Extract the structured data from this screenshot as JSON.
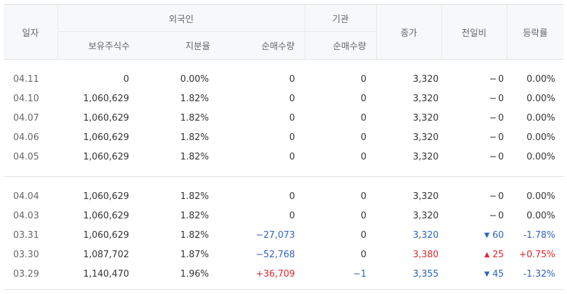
{
  "header": {
    "date": "일자",
    "foreign": "외국인",
    "institution": "기관",
    "close": "종가",
    "change": "전일비",
    "rate": "등락률",
    "holdings": "보유주식수",
    "ratio": "지분율",
    "foreign_net": "순매수량",
    "inst_net": "순매수량"
  },
  "colors": {
    "up": "#e0262b",
    "down": "#2d63c8",
    "header_bg": "#f7f8fa"
  },
  "groups": [
    {
      "rows": [
        {
          "date": "04.11",
          "holdings": "0",
          "ratio": "0.00%",
          "foreign_net": "0",
          "inst_net": "0",
          "close": "3,320",
          "change": "0",
          "rate": "0.00%",
          "dir": "none",
          "fnet_dir": "none",
          "inet_dir": "none"
        },
        {
          "date": "04.10",
          "holdings": "1,060,629",
          "ratio": "1.82%",
          "foreign_net": "0",
          "inst_net": "0",
          "close": "3,320",
          "change": "0",
          "rate": "0.00%",
          "dir": "none",
          "fnet_dir": "none",
          "inet_dir": "none"
        },
        {
          "date": "04.07",
          "holdings": "1,060,629",
          "ratio": "1.82%",
          "foreign_net": "0",
          "inst_net": "0",
          "close": "3,320",
          "change": "0",
          "rate": "0.00%",
          "dir": "none",
          "fnet_dir": "none",
          "inet_dir": "none"
        },
        {
          "date": "04.06",
          "holdings": "1,060,629",
          "ratio": "1.82%",
          "foreign_net": "0",
          "inst_net": "0",
          "close": "3,320",
          "change": "0",
          "rate": "0.00%",
          "dir": "none",
          "fnet_dir": "none",
          "inet_dir": "none"
        },
        {
          "date": "04.05",
          "holdings": "1,060,629",
          "ratio": "1.82%",
          "foreign_net": "0",
          "inst_net": "0",
          "close": "3,320",
          "change": "0",
          "rate": "0.00%",
          "dir": "none",
          "fnet_dir": "none",
          "inet_dir": "none"
        }
      ]
    },
    {
      "rows": [
        {
          "date": "04.04",
          "holdings": "1,060,629",
          "ratio": "1.82%",
          "foreign_net": "0",
          "inst_net": "0",
          "close": "3,320",
          "change": "0",
          "rate": "0.00%",
          "dir": "none",
          "fnet_dir": "none",
          "inet_dir": "none"
        },
        {
          "date": "04.03",
          "holdings": "1,060,629",
          "ratio": "1.82%",
          "foreign_net": "0",
          "inst_net": "0",
          "close": "3,320",
          "change": "0",
          "rate": "0.00%",
          "dir": "none",
          "fnet_dir": "none",
          "inet_dir": "none"
        },
        {
          "date": "03.31",
          "holdings": "1,060,629",
          "ratio": "1.82%",
          "foreign_net": "−27,073",
          "inst_net": "0",
          "close": "3,320",
          "change": "60",
          "rate": "-1.78%",
          "dir": "down",
          "fnet_dir": "down",
          "inet_dir": "none"
        },
        {
          "date": "03.30",
          "holdings": "1,087,702",
          "ratio": "1.87%",
          "foreign_net": "−52,768",
          "inst_net": "0",
          "close": "3,380",
          "change": "25",
          "rate": "+0.75%",
          "dir": "up",
          "fnet_dir": "down",
          "inet_dir": "none"
        },
        {
          "date": "03.29",
          "holdings": "1,140,470",
          "ratio": "1.96%",
          "foreign_net": "+36,709",
          "inst_net": "−1",
          "close": "3,355",
          "change": "45",
          "rate": "-1.32%",
          "dir": "down",
          "fnet_dir": "up",
          "inet_dir": "down"
        }
      ]
    }
  ]
}
